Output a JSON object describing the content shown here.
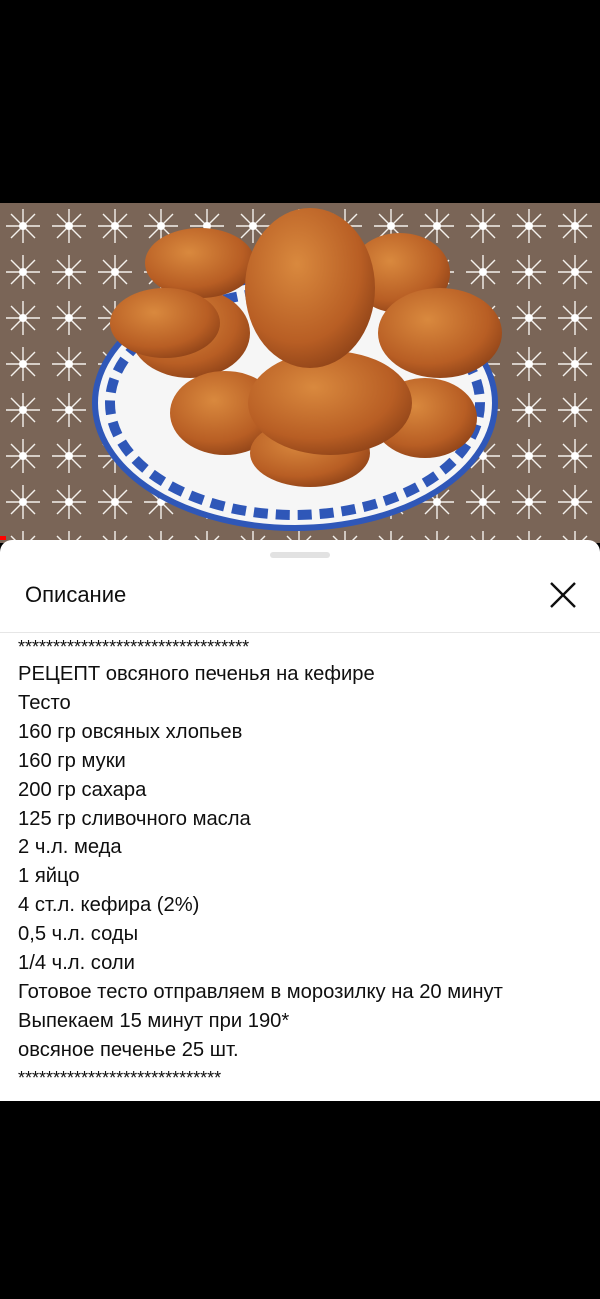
{
  "sheet": {
    "title": "Описание"
  },
  "description": {
    "lines": [
      "*********************************",
      "РЕЦЕПТ овсяного печенья на кефире",
      "Тесто",
      "160 гр овсяных хлопьев",
      "160 гр муки",
      "200 гр сахара",
      "125 гр сливочного масла",
      "2 ч.л. меда",
      "1 яйцо",
      "4 ст.л. кефира (2%)",
      "0,5 ч.л. соды",
      "1/4 ч.л. соли",
      "Готовое тесто отправляем в морозилку на 20 минут",
      "Выпекаем 15 минут при 190*",
      "овсяное печенье 25 шт.",
      "*****************************"
    ]
  },
  "icons": {
    "close": "close-icon"
  },
  "colors": {
    "progress": "#ff0000",
    "cookie": "#c66a2a",
    "plate_pattern": "#2f57b8"
  }
}
